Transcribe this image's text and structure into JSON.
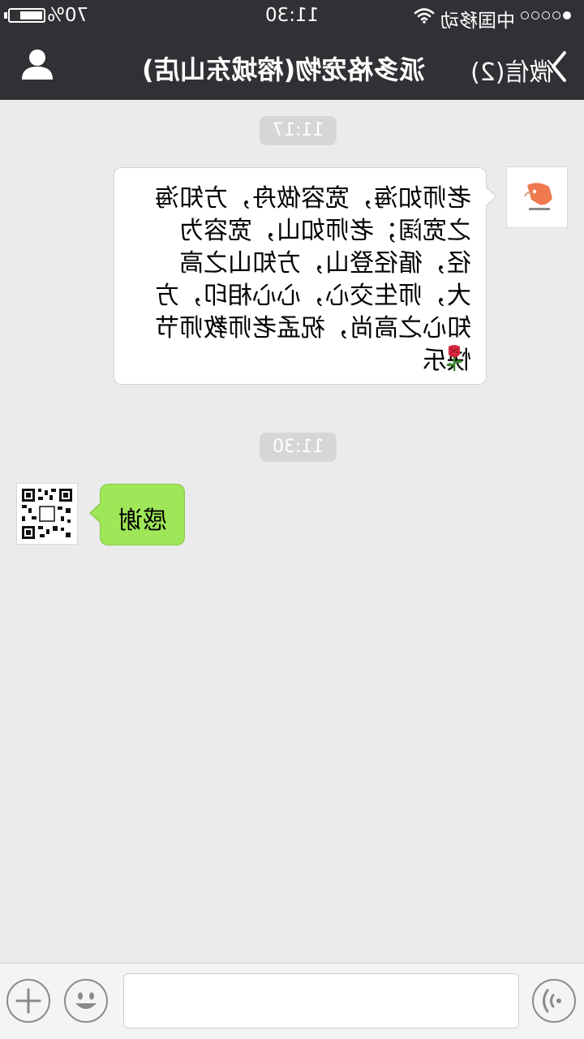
{
  "status_bar": {
    "battery_percent": "70%",
    "battery_level": 0.7,
    "time": "11:30",
    "carrier": "中国移动",
    "signal_strength": 1
  },
  "nav": {
    "title": "派多格宠物(榕城东山店)",
    "back_label": "微信(2)"
  },
  "messages": {
    "timestamp1": "11:17",
    "msg1_text": "老师如海，宽容做舟，方知海之宽阔；老师如山，宽容为径，循径登山，方知山之高大，师生交心，心心相印，方知心之高尚，祝孟老师教师节快乐",
    "timestamp2": "11:30",
    "msg2_text": "感谢"
  },
  "input": {
    "placeholder": ""
  },
  "colors": {
    "bar_bg": "#2f3134",
    "chat_bg": "#ebebeb",
    "sent_bubble": "#9fe658",
    "received_bubble": "#ffffff"
  },
  "icons": [
    "contact-icon",
    "back-chevron-icon",
    "wifi-icon",
    "battery-icon",
    "rose-emoji-icon",
    "plus-icon",
    "emoji-icon",
    "voice-icon",
    "qr-code-avatar",
    "dog-logo-avatar"
  ]
}
